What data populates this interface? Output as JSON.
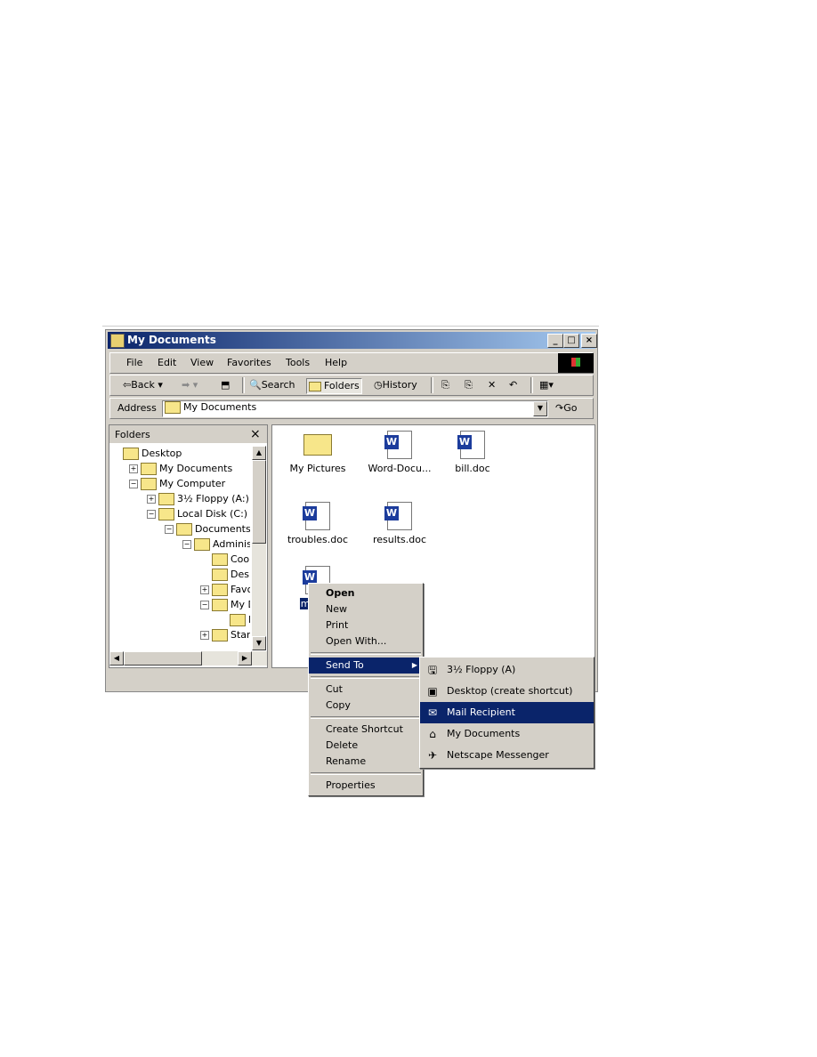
{
  "window": {
    "title": "My Documents",
    "minimize": "_",
    "maximize": "□",
    "close": "×"
  },
  "menu": [
    "File",
    "Edit",
    "View",
    "Favorites",
    "Tools",
    "Help"
  ],
  "toolbar": {
    "back": "Back",
    "search": "Search",
    "folders": "Folders",
    "history": "History"
  },
  "address": {
    "label": "Address",
    "value": "My Documents",
    "go": "Go"
  },
  "folders_pane": {
    "title": "Folders",
    "close": "×",
    "tree": [
      {
        "label": "Desktop",
        "level": 0
      },
      {
        "label": "My Documents",
        "level": 1,
        "exp": "+"
      },
      {
        "label": "My Computer",
        "level": 1,
        "exp": "−"
      },
      {
        "label": "3½ Floppy (A:)",
        "level": 2,
        "exp": "+"
      },
      {
        "label": "Local Disk (C:)",
        "level": 2,
        "exp": "−"
      },
      {
        "label": "Documents an",
        "level": 3,
        "exp": "−"
      },
      {
        "label": "Administra",
        "level": 4,
        "exp": "−"
      },
      {
        "label": "Cookie",
        "level": 5
      },
      {
        "label": "Deskto",
        "level": 5
      },
      {
        "label": "Favori",
        "level": 5,
        "exp": "+"
      },
      {
        "label": "My Do",
        "level": 5,
        "exp": "−"
      },
      {
        "label": "My",
        "level": 6
      },
      {
        "label": "Start M",
        "level": 5,
        "exp": "+"
      }
    ]
  },
  "files": [
    {
      "name": "My Pictures",
      "type": "folder"
    },
    {
      "name": "Word-Docu...",
      "type": "doc"
    },
    {
      "name": "bill.doc",
      "type": "doc"
    },
    {
      "name": "troubles.doc",
      "type": "doc"
    },
    {
      "name": "results.doc",
      "type": "doc"
    },
    {
      "name": "meetin",
      "type": "doc",
      "selected": true
    }
  ],
  "context_menu": {
    "groups": [
      [
        "Open",
        "New",
        "Print",
        "Open With..."
      ],
      [
        "Send To"
      ],
      [
        "Cut",
        "Copy"
      ],
      [
        "Create Shortcut",
        "Delete",
        "Rename"
      ],
      [
        "Properties"
      ]
    ],
    "default": "Open",
    "active": "Send To"
  },
  "send_to": {
    "items": [
      {
        "label": "3½ Floppy (A)",
        "icon": "floppy-icon"
      },
      {
        "label": "Desktop (create shortcut)",
        "icon": "desktop-icon"
      },
      {
        "label": "Mail Recipient",
        "icon": "mail-icon"
      },
      {
        "label": "My Documents",
        "icon": "my-documents-icon"
      },
      {
        "label": "Netscape Messenger",
        "icon": "netscape-icon"
      }
    ],
    "highlighted": "Mail Recipient"
  },
  "colors": {
    "selection": "#0a246a",
    "face": "#d4d0c8"
  }
}
